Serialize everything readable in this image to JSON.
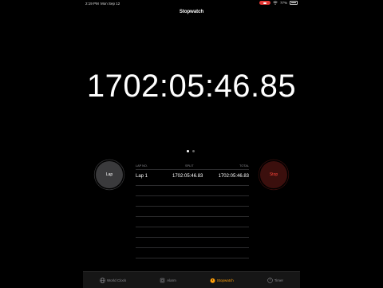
{
  "status": {
    "time": "2:19 PM",
    "date": "Mon Sep 12",
    "battery": "77%",
    "battery_level": 0.77
  },
  "title": "Stopwatch",
  "stopwatch": {
    "time": "1702:05:46.85"
  },
  "page_dots": {
    "count": 2,
    "active": 0
  },
  "buttons": {
    "lap": "Lap",
    "stop": "Stop"
  },
  "laps": {
    "headers": {
      "no": "LAP NO.",
      "split": "SPLIT",
      "total": "TOTAL"
    },
    "rows": [
      {
        "name": "Lap 1",
        "split": "1702:05:46.83",
        "total": "1702:05:46.83"
      }
    ]
  },
  "tabs": [
    {
      "label": "World Clock",
      "icon": "globe-icon"
    },
    {
      "label": "Alarm",
      "icon": "alarm-icon"
    },
    {
      "label": "Stopwatch",
      "icon": "stopwatch-icon",
      "active": true
    },
    {
      "label": "Timer",
      "icon": "timer-icon"
    }
  ],
  "colors": {
    "accent": "#ff9f0a",
    "stop_text": "#ff453a",
    "stop_bg": "#3b0f0d",
    "lap_bg": "#3a3a3c",
    "background": "#000000"
  }
}
